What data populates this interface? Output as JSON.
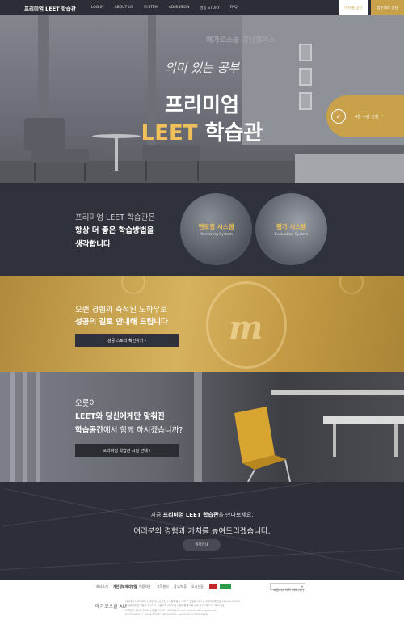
{
  "nav": {
    "brand": "프리미엄 LEET 학습관",
    "links": [
      "LOG-IN",
      "ABOUT US",
      "SYSTEM",
      "ADMISSION",
      "성공 STORY",
      "FAQ"
    ],
    "button_apply": "에듀윌 공단",
    "button_consult": "방문예약 상담"
  },
  "hero": {
    "bg_sign": "메가로스쿨 강남캠퍼스",
    "tagline": "의미 있는 공부",
    "title_line1": "프리미엄",
    "title_gold": "LEET",
    "title_white": "학습관",
    "cta_label": "4월 수강 신청",
    "cta_arrow": "›",
    "cta_icon": "✓"
  },
  "section1": {
    "line1": "프리미엄 LEET 학습관은",
    "line2": "항상 더 좋은 학습방법을",
    "line3": "생각합니다",
    "circle1_title": "멘토링 시스템",
    "circle1_sub": "Mentoring System",
    "circle2_title": "평가 시스템",
    "circle2_sub": "Evaluation System"
  },
  "section2": {
    "line1": "오랜 경험과 축적된 노하우로",
    "line2": "성공의 길로 안내해 드립니다",
    "button": "성공 스토리 확인하기  ›",
    "emblem": "m"
  },
  "section3": {
    "line1": "오롯이",
    "line2": "LEET와 당신에게만 맞춰진",
    "line3_bold": "학습공간",
    "line3_rest": "에서 함께 하시겠습니까?",
    "button": "프리미엄 학습관 시설 안내  ›"
  },
  "section4": {
    "line1_pre": "지금 ",
    "line1_bold": "프리미엄 LEET 학습관",
    "line1_post": "을 만나보세요.",
    "line2": "여러분의 경험과 가치를 높여드리겠습니다.",
    "button": "위치안내"
  },
  "footer": {
    "links": [
      "회사소개",
      "개인정보처리방침",
      "이용약관",
      "고객센터",
      "광고/제휴",
      "오시는길"
    ],
    "active_index": 1,
    "select_value": "패밀리사이트 바로가기",
    "logo_text": "메가로스쿨 AU",
    "info": [
      "(주)메가스터디교육 | 대표이사 손은진 | 서울특별시 서초구 효령로 321 | 사업자등록번호 120-81-00000",
      "통신판매업신고번호 제2015-서울서초-0000호 | 원격평생교육시설 신고 서울서초 제000호",
      "고객센터 1599-0000 | 평일 09:00~18:00 | E-mail: premium@megals.co.kr",
      "COPYRIGHT ⓒ MEGASTUDY EDUCATION. ALL RIGHTS RESERVED."
    ]
  },
  "colors": {
    "gold": "#c9a14a",
    "dark": "#2f323a",
    "nav": "#2b2e36"
  }
}
